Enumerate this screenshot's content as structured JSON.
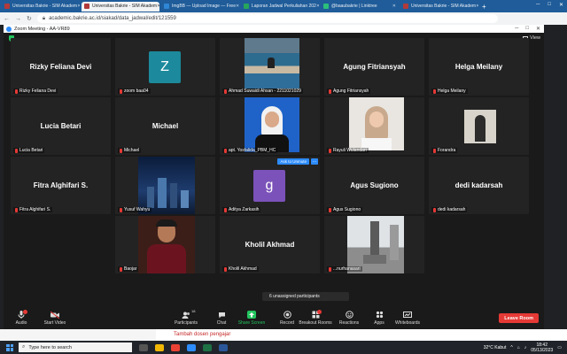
{
  "browser": {
    "tabs": [
      {
        "title": "Universitas Bakrie - SIM Akadem",
        "color": "#b23a3a",
        "active": false
      },
      {
        "title": "Universitas Bakrie - SIM Akadem",
        "color": "#b23a3a",
        "active": true
      },
      {
        "title": "ImgBB — Upload Image — Free",
        "color": "#2f86d6",
        "active": false
      },
      {
        "title": "Laporan Jadwal Perkuliahan 202",
        "color": "#26a65b",
        "active": false
      },
      {
        "title": "@baaubakrie | Linktree",
        "color": "#2bbf7a",
        "active": false
      },
      {
        "title": "Universitas Bakrie - SIM Akadem",
        "color": "#b23a3a",
        "active": false
      }
    ],
    "new_tab": "+",
    "address": "academic.bakrie.ac.id/siakad/data_jadwal/edit/121559"
  },
  "zoom": {
    "title": "Zoom Meeting - AA-VR89",
    "view_label": "View",
    "tiles": [
      {
        "name": "Rizky Feliana Devi",
        "label": "Rizky Feliana Devi",
        "kind": "name"
      },
      {
        "name": "",
        "label": "zoom baa04",
        "kind": "avatar",
        "initial": "Z",
        "color": "#1c8a9c"
      },
      {
        "name": "",
        "label": "Ahmad Suwaidi Ahsan - 2211021029",
        "kind": "photo-beach"
      },
      {
        "name": "Agung Fitriansyah",
        "label": "Agung Fitriansyah",
        "kind": "name"
      },
      {
        "name": "Helga Meilany",
        "label": "Helga Meilany",
        "kind": "name"
      },
      {
        "name": "Lucia Betari",
        "label": "Lucia Betari",
        "kind": "name"
      },
      {
        "name": "Michael",
        "label": "Michael",
        "kind": "name"
      },
      {
        "name": "",
        "label": "apt. Yosfalida_PBM_HC",
        "kind": "photo-hijab-blue"
      },
      {
        "name": "",
        "label": "Rayuli Wulandari",
        "kind": "photo-hijab-light"
      },
      {
        "name": "",
        "label": "Forandra",
        "kind": "photo-small"
      },
      {
        "name": "Fitra Alghifari S.",
        "label": "Fitra Alghifari S.",
        "kind": "name"
      },
      {
        "name": "",
        "label": "Yusuf Wahyu",
        "kind": "photo-city"
      },
      {
        "name": "",
        "label": "Aditya Zarkasih",
        "kind": "avatar",
        "initial": "g",
        "color": "#7b52b9"
      },
      {
        "name": "Agus Sugiono",
        "label": "Agus Sugiono",
        "kind": "name"
      },
      {
        "name": "dedi kadarsah",
        "label": "dedi kadarsah",
        "kind": "name"
      },
      {
        "name": "",
        "label": "",
        "kind": "empty"
      },
      {
        "name": "",
        "label": "Baojar",
        "kind": "photo-man"
      },
      {
        "name": "Kholil Akhmad",
        "label": "Kholil Akhmad",
        "kind": "name"
      },
      {
        "name": "",
        "label": "...nurhanasari",
        "kind": "photo-statue"
      }
    ],
    "ask_to_unmute": "Ask to Unmute",
    "more": "···",
    "unassigned": "6 unassigned participants",
    "toolbar": [
      {
        "label": "Audio",
        "icon": "audio-icon"
      },
      {
        "label": "Start Video",
        "icon": "video-icon"
      },
      {
        "label": "Participants",
        "icon": "participants-icon",
        "count": "18"
      },
      {
        "label": "Chat",
        "icon": "chat-icon"
      },
      {
        "label": "Share Screen",
        "icon": "share-screen-icon"
      },
      {
        "label": "Record",
        "icon": "record-icon"
      },
      {
        "label": "Breakout Rooms",
        "icon": "breakout-rooms-icon"
      },
      {
        "label": "Reactions",
        "icon": "reactions-icon"
      },
      {
        "label": "Apps",
        "icon": "apps-icon"
      },
      {
        "label": "Whiteboards",
        "icon": "whiteboards-icon"
      }
    ],
    "leave": "Leave Room"
  },
  "page_below": {
    "link": "Tambah dosen pengajar"
  },
  "taskbar": {
    "search_placeholder": "Type here to search",
    "weather": "32°C  Kabut",
    "time": "18:42",
    "date": "05/13/2023"
  }
}
